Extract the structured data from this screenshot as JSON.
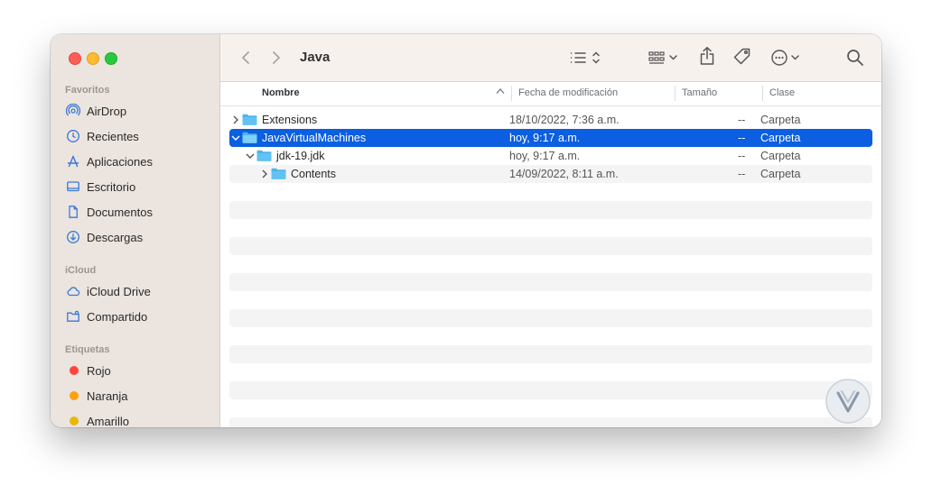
{
  "window_title": "Java",
  "sidebar": {
    "sections": [
      {
        "header": "Favoritos"
      },
      {
        "header": "iCloud"
      },
      {
        "header": "Etiquetas"
      }
    ],
    "favorites": [
      {
        "label": "AirDrop",
        "icon": "airdrop-icon"
      },
      {
        "label": "Recientes",
        "icon": "clock-icon"
      },
      {
        "label": "Aplicaciones",
        "icon": "applications-icon"
      },
      {
        "label": "Escritorio",
        "icon": "desktop-icon"
      },
      {
        "label": "Documentos",
        "icon": "document-icon"
      },
      {
        "label": "Descargas",
        "icon": "download-icon"
      }
    ],
    "icloud": [
      {
        "label": "iCloud Drive",
        "icon": "cloud-icon"
      },
      {
        "label": "Compartido",
        "icon": "shared-folder-icon"
      }
    ],
    "tags": [
      {
        "label": "Rojo",
        "color": "#ff453a"
      },
      {
        "label": "Naranja",
        "color": "#ff9f0a"
      },
      {
        "label": "Amarillo",
        "color": "#e8b70b"
      }
    ]
  },
  "toolbar": {
    "icons": [
      "back-icon",
      "forward-icon",
      "list-view-icon",
      "group-icon",
      "share-icon",
      "tag-icon",
      "more-icon",
      "search-icon"
    ]
  },
  "columns": {
    "name": "Nombre",
    "date": "Fecha de modificación",
    "size": "Tamaño",
    "kind": "Clase"
  },
  "files": [
    {
      "name": "Extensions",
      "date": "18/10/2022, 7:36 a.m.",
      "size": "--",
      "kind": "Carpeta",
      "depth": 0,
      "expanded": false,
      "selected": false
    },
    {
      "name": "JavaVirtualMachines",
      "date": "hoy, 9:17 a.m.",
      "size": "--",
      "kind": "Carpeta",
      "depth": 0,
      "expanded": true,
      "selected": true
    },
    {
      "name": "jdk-19.jdk",
      "date": "hoy, 9:17 a.m.",
      "size": "--",
      "kind": "Carpeta",
      "depth": 1,
      "expanded": true,
      "selected": false
    },
    {
      "name": "Contents",
      "date": "14/09/2022, 8:11 a.m.",
      "size": "--",
      "kind": "Carpeta",
      "depth": 2,
      "expanded": false,
      "selected": false
    }
  ],
  "colors": {
    "selection": "#0b5fe0",
    "folder": "#4fb4ea",
    "sidebar_bg": "#ebe4df"
  }
}
